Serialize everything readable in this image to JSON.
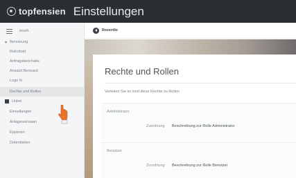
{
  "header": {
    "brand": "topfensien",
    "brand_sub": "",
    "title": "Einstellungen"
  },
  "sidebar": {
    "search_label": "ieneh",
    "section1": "Benutzung",
    "items1": [
      "Rolnsbatt",
      "Anfragsberichalte",
      "Ansatzt Benoard",
      "Logo N",
      "Rechte und Rollen"
    ],
    "section2": "Unbei",
    "items2": [
      "Einsellungen",
      "Anlageseinsaan",
      "Eppsnen",
      "Doterdishen"
    ]
  },
  "content": {
    "back_label": "Rezerdie",
    "page_title": "Rechte und Rollen",
    "description": "Verteilen Sie so sind diese Rechte zu Rollen",
    "roles": [
      {
        "name": "Administrator",
        "label": "Zuordnung",
        "value": "Beschreibung zur Rolle Administrator"
      },
      {
        "name": "Benutzer",
        "label": "Zuordnung",
        "value": "Beschreibung zur Rolle Benutzer"
      }
    ]
  },
  "colors": {
    "topbar": "#2b2f33",
    "sidebar": "#f4f5f6",
    "cursor": "#e8742a"
  },
  "icons": {
    "logo": "brand-logo-icon",
    "menu": "hamburger-menu-icon",
    "back": "back-arrow-icon",
    "cursor": "hand-pointer-icon"
  }
}
